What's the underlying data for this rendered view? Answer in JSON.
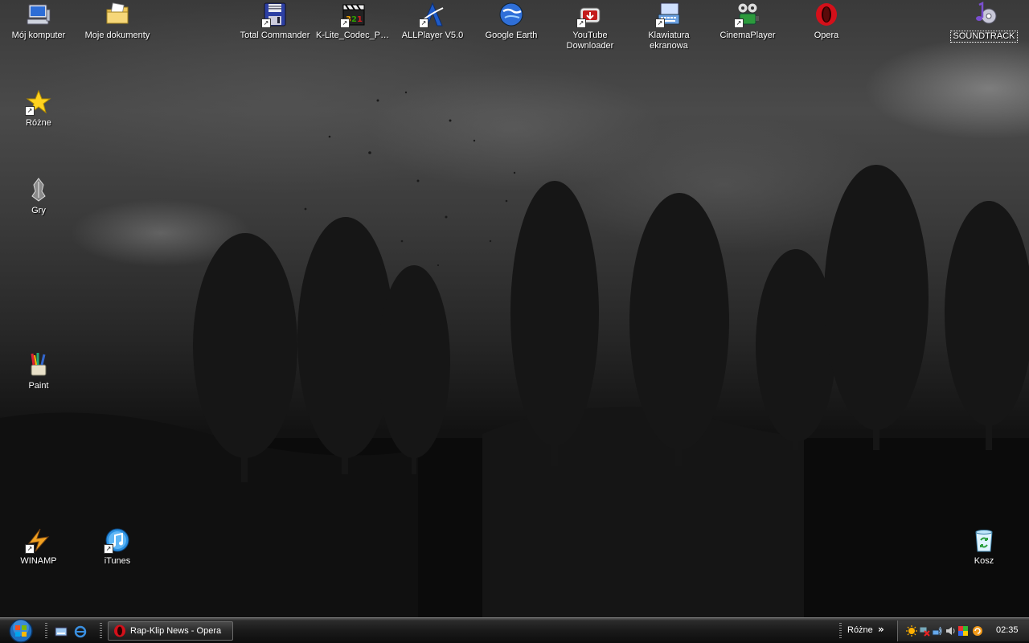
{
  "desktop": {
    "icons": {
      "moj_komputer": "Mój komputer",
      "moje_dokumenty": "Moje dokumenty",
      "total_commander": "Total Commander",
      "klite": "K-Lite_Codec_Pa...",
      "allplayer": "ALLPlayer V5.0",
      "google_earth": "Google Earth",
      "youtube_downloader": "YouTube Downloader",
      "klawiatura": "Klawiatura ekranowa",
      "cinemaplayer": "CinemaPlayer",
      "opera": "Opera",
      "soundtrack": "SOUNDTRACK",
      "rozne": "Różne",
      "gry": "Gry",
      "paint": "Paint",
      "winamp": "WINAMP",
      "itunes": "iTunes",
      "kosz": "Kosz"
    },
    "colors": {
      "opera_red": "#d4101a",
      "itunes_blue": "#2a8fe0",
      "start_orb_blue": "#1f6fc0"
    }
  },
  "taskbar": {
    "tasks": [
      {
        "label": "Rap-Klip News - Opera",
        "icon": "opera-icon"
      }
    ],
    "toolbar_label": "Różne",
    "toolbar_chevron": "»",
    "clock": "02:35"
  }
}
